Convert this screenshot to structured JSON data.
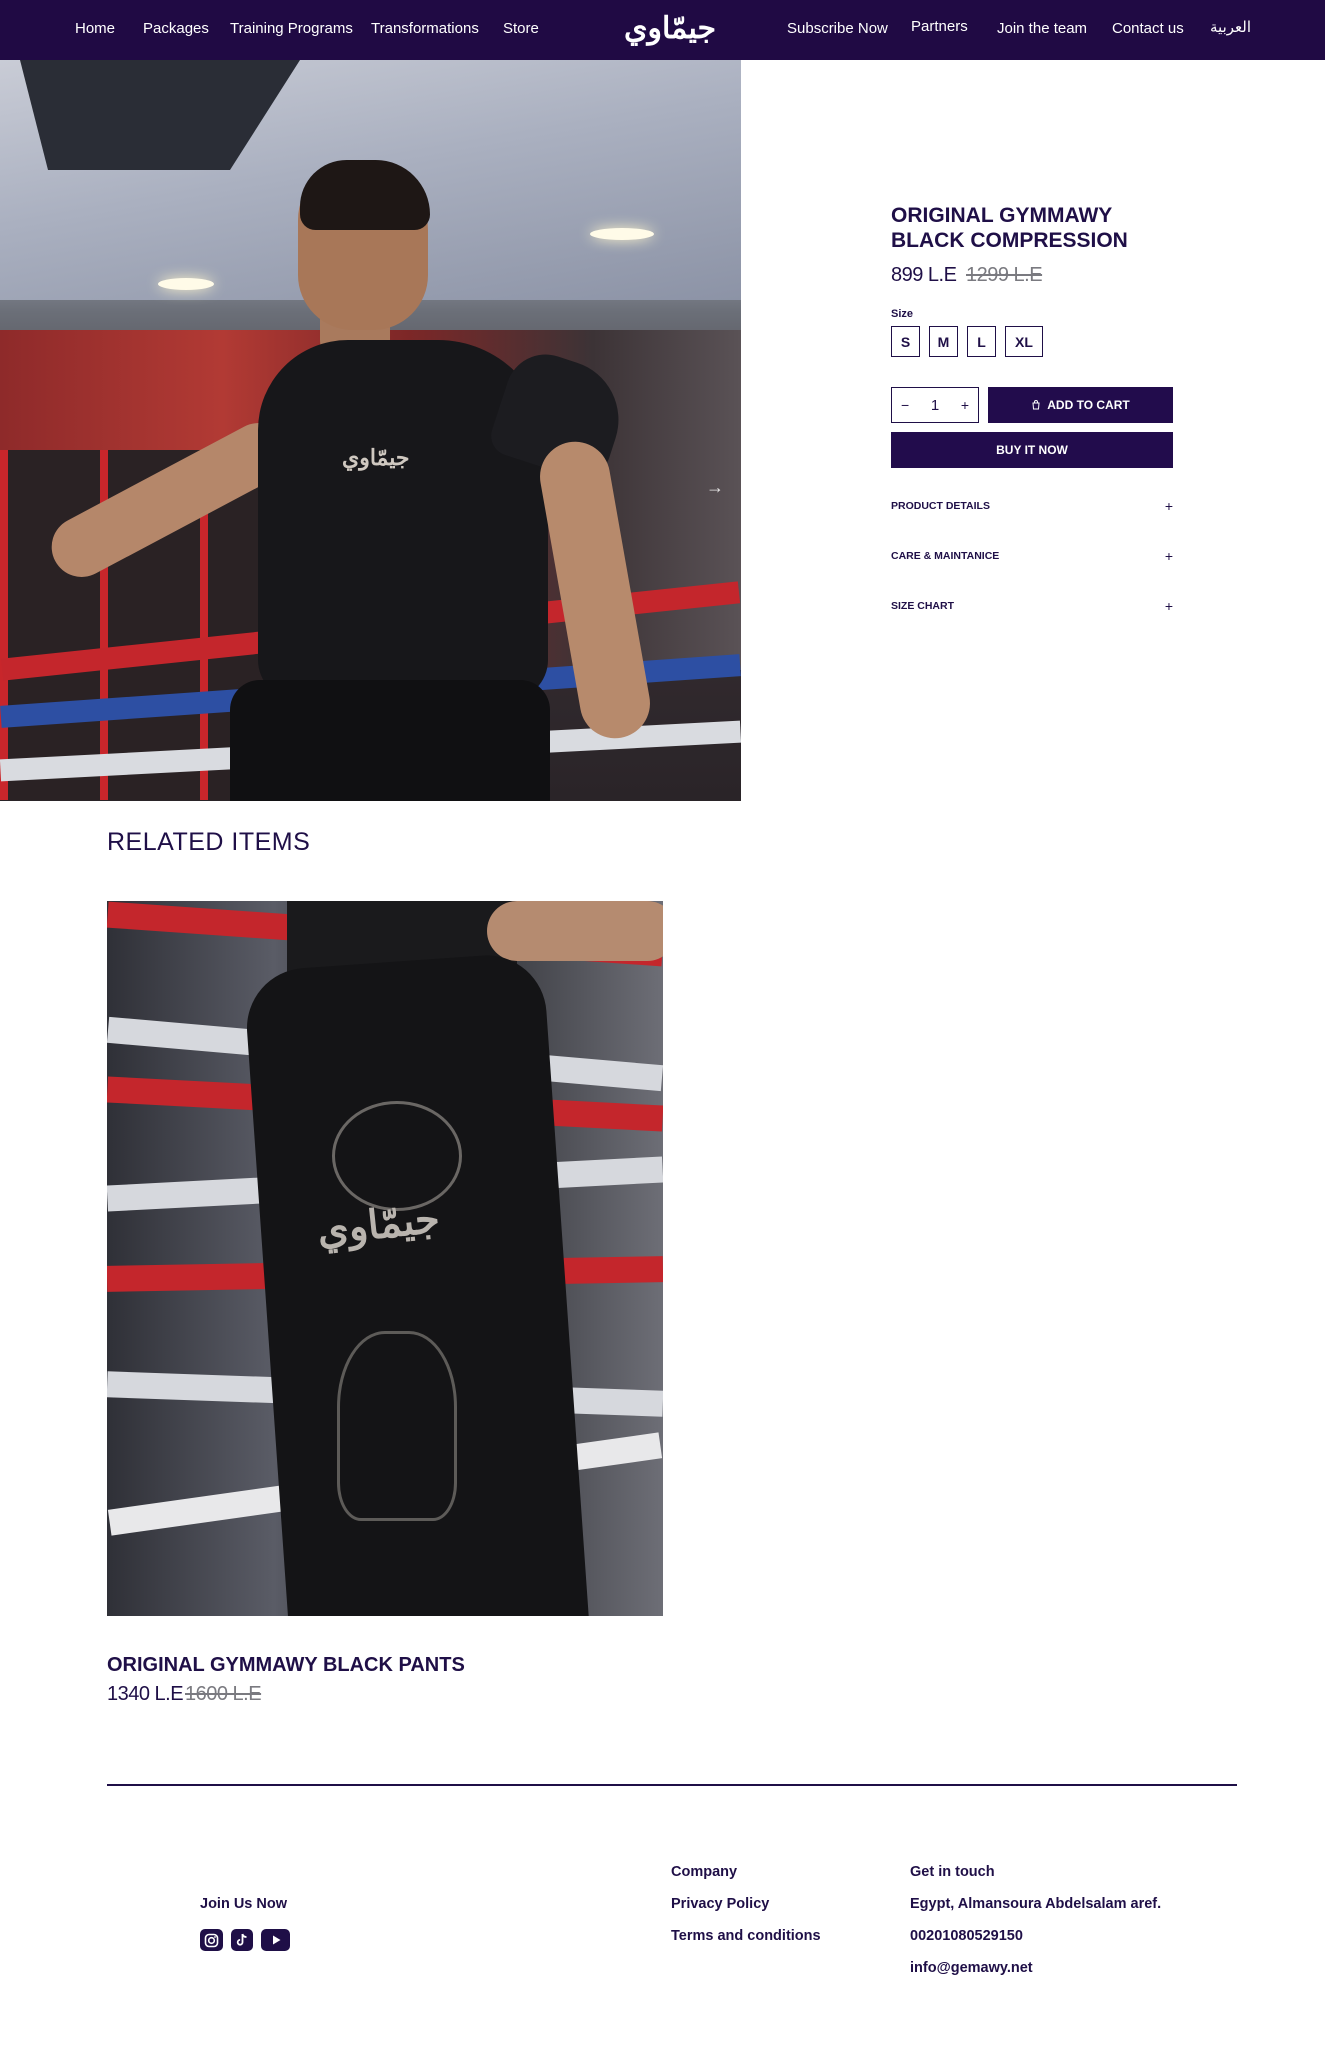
{
  "nav": {
    "left_items": [
      "Home",
      "Packages",
      "Training Programs",
      "Transformations",
      "Store"
    ],
    "logo_text": "جيمّاوي",
    "right_items": [
      "Subscribe Now",
      "Partners",
      "Join the team",
      "Contact us",
      "العربية"
    ]
  },
  "hero": {
    "shirt_print": "جيمّاوي",
    "next_arrow": "→"
  },
  "product": {
    "title": "ORIGINAL GYMMAWY BLACK COMPRESSION",
    "price": "899 L.E",
    "old_price": "1299 L.E",
    "size_label": "Size",
    "sizes": [
      "S",
      "M",
      "L",
      "XL"
    ],
    "quantity": "1",
    "qty_minus": "−",
    "qty_plus": "+",
    "add_to_cart": "ADD TO CART",
    "buy_now": "BUY IT NOW",
    "accordions": [
      "PRODUCT DETAILS",
      "CARE & MAINTANICE",
      "SIZE CHART"
    ],
    "accordion_icon": "+"
  },
  "related": {
    "heading": "RELATED ITEMS",
    "item_print": "جيمّاوي",
    "item_name": "ORIGINAL GYMMAWY BLACK PANTS",
    "item_price": "1340 L.E",
    "item_old_price": "1600 L.E"
  },
  "footer": {
    "join_label": "Join Us Now",
    "social_icons": [
      "instagram-icon",
      "tiktok-icon",
      "youtube-icon"
    ],
    "company_links": [
      "Company",
      "Privacy Policy",
      "Terms and conditions"
    ],
    "contact_heading": "Get in touch",
    "address": "Egypt, Almansoura Abdelsalam aref.",
    "phone": "00201080529150",
    "email": "info@gemawy.net"
  },
  "colors": {
    "brand_dark": "#200a44",
    "text_primary": "#1f0f47",
    "strike_gray": "#7a7a80"
  }
}
